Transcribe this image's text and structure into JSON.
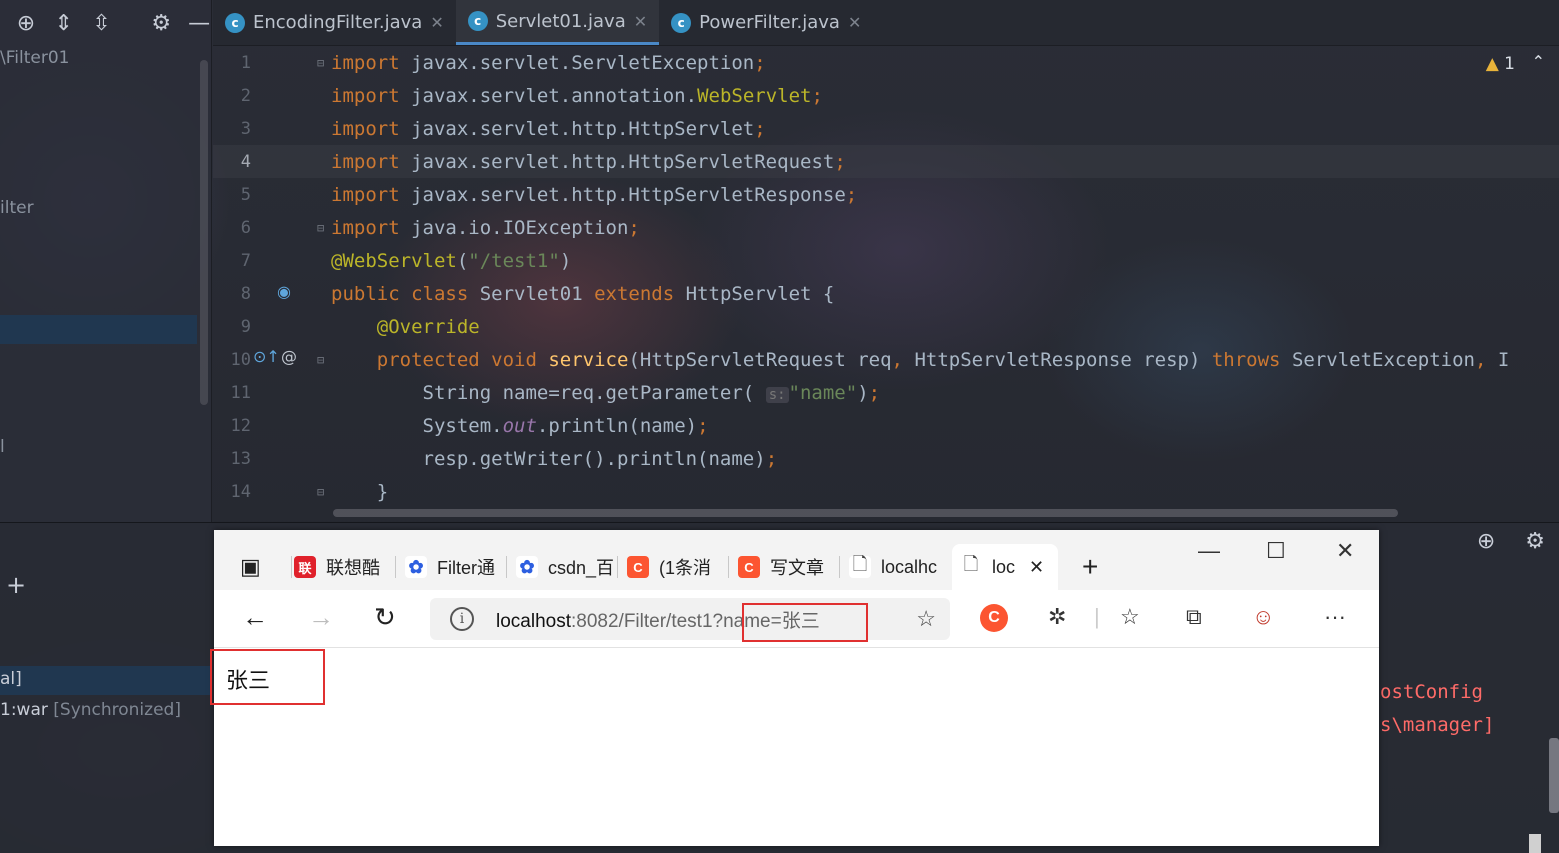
{
  "ide": {
    "project_tree": {
      "items": [
        "\\Filter01",
        "ilter",
        "l"
      ],
      "bottom_items": [
        "al]",
        "1:war"
      ],
      "sync_status": "[Synchronized]"
    },
    "tabs": [
      {
        "label": "EncodingFilter.java",
        "active": false
      },
      {
        "label": "Servlet01.java",
        "active": true
      },
      {
        "label": "PowerFilter.java",
        "active": false
      }
    ],
    "warning_count": "1",
    "current_line": 4,
    "code_lines": [
      {
        "n": "1",
        "tokens": [
          [
            "kw",
            "import "
          ],
          [
            "pl",
            "javax.servlet.ServletException"
          ],
          [
            "kw",
            ";"
          ]
        ]
      },
      {
        "n": "2",
        "tokens": [
          [
            "kw",
            "import "
          ],
          [
            "pl",
            "javax.servlet.annotation."
          ],
          [
            "ann",
            "WebServlet"
          ],
          [
            "kw",
            ";"
          ]
        ]
      },
      {
        "n": "3",
        "tokens": [
          [
            "kw",
            "import "
          ],
          [
            "pl",
            "javax.servlet.http.HttpServlet"
          ],
          [
            "kw",
            ";"
          ]
        ]
      },
      {
        "n": "4",
        "tokens": [
          [
            "kw",
            "import "
          ],
          [
            "pl",
            "javax.servlet.http.HttpServletRequest"
          ],
          [
            "kw",
            ";"
          ]
        ]
      },
      {
        "n": "5",
        "tokens": [
          [
            "kw",
            "import "
          ],
          [
            "pl",
            "javax.servlet.http.HttpServletResponse"
          ],
          [
            "kw",
            ";"
          ]
        ]
      },
      {
        "n": "6",
        "tokens": [
          [
            "kw",
            "import "
          ],
          [
            "pl",
            "java.io.IOException"
          ],
          [
            "kw",
            ";"
          ]
        ]
      },
      {
        "n": "7",
        "tokens": [
          [
            "ann",
            "@WebServlet"
          ],
          [
            "pl",
            "("
          ],
          [
            "str",
            "\"/test1\""
          ],
          [
            "pl",
            ")"
          ]
        ]
      },
      {
        "n": "8",
        "tokens": [
          [
            "kw",
            "public class "
          ],
          [
            "pl",
            "Servlet01 "
          ],
          [
            "kw",
            "extends "
          ],
          [
            "pl",
            "HttpServlet {"
          ]
        ]
      },
      {
        "n": "9",
        "tokens": [
          [
            "pl",
            "    "
          ],
          [
            "ann",
            "@Override"
          ]
        ]
      },
      {
        "n": "10",
        "tokens": [
          [
            "pl",
            "    "
          ],
          [
            "kw",
            "protected void "
          ],
          [
            "fn",
            "service"
          ],
          [
            "pl",
            "(HttpServletRequest req"
          ],
          [
            "kw",
            ", "
          ],
          [
            "pl",
            "HttpServletResponse resp) "
          ],
          [
            "kw",
            "throws "
          ],
          [
            "pl",
            "ServletException"
          ],
          [
            "kw",
            ", "
          ],
          [
            "pl",
            "I"
          ]
        ]
      },
      {
        "n": "11",
        "tokens": [
          [
            "pl",
            "        String name=req.getParameter( "
          ],
          [
            "hint",
            "s:"
          ],
          [
            "str",
            "\"name\""
          ],
          [
            "pl",
            ")"
          ],
          [
            "kw",
            ";"
          ]
        ]
      },
      {
        "n": "12",
        "tokens": [
          [
            "pl",
            "        System."
          ],
          [
            "st",
            "out"
          ],
          [
            "pl",
            ".println(name)"
          ],
          [
            "kw",
            ";"
          ]
        ]
      },
      {
        "n": "13",
        "tokens": [
          [
            "pl",
            "        resp.getWriter().println(name)"
          ],
          [
            "kw",
            ";"
          ]
        ]
      },
      {
        "n": "14",
        "tokens": [
          [
            "pl",
            "    }"
          ]
        ]
      }
    ],
    "console_lines": [
      "ostConfig",
      "s\\manager]"
    ]
  },
  "browser": {
    "tabs": [
      {
        "label": "联想酷",
        "icon": "lenovo-icon"
      },
      {
        "label": "Filter通",
        "icon": "baidu-icon"
      },
      {
        "label": "csdn_百",
        "icon": "baidu-icon"
      },
      {
        "label": "(1条消",
        "icon": "csdn-icon"
      },
      {
        "label": "写文章",
        "icon": "csdn-icon"
      },
      {
        "label": "localhc",
        "icon": "page-icon"
      },
      {
        "label": "loc",
        "icon": "page-icon",
        "active": true
      }
    ],
    "new_tab": "+",
    "address": {
      "host": "localhost",
      "path": ":8082/Filter/test1?",
      "query": "name=张三"
    },
    "page_content": "张三"
  }
}
